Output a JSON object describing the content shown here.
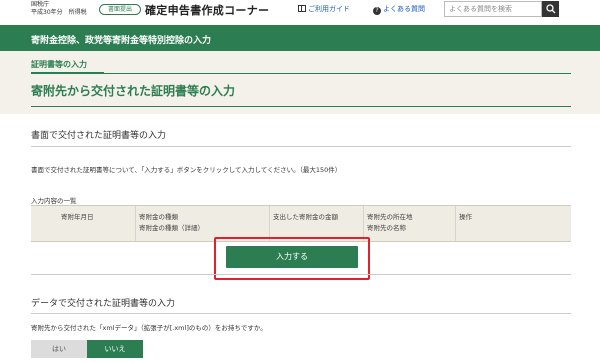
{
  "header": {
    "agency_line1": "国税庁",
    "agency_line2": "平成30年分　所得税",
    "badge": "書面提出",
    "app_title": "確定申告書作成コーナー",
    "guide_link": "ご利用ガイド",
    "faq_link": "よくある質問",
    "search_placeholder": "よくある質問を検索"
  },
  "band": {
    "title": "寄附金控除、政党等寄附金等特別控除の入力"
  },
  "section": {
    "step_label": "証明書等の入力",
    "page_title": "寄附先から交付された証明書等の入力"
  },
  "paper": {
    "heading": "書面で交付された証明書等の入力",
    "description": "書面で交付された証明書等について、「入力する」ボタンをクリックして入力してください。（最大150件）",
    "list_caption": "入力内容の一覧",
    "columns": [
      "寄附年月日",
      "寄附金の種類",
      "寄附金の種類（詳細）",
      "支出した寄附金の金額",
      "寄附先の所在地",
      "寄附先の名称",
      "操作"
    ],
    "input_button": "入力する"
  },
  "data": {
    "heading": "データで交付された証明書等の入力",
    "question": "寄附先から交付された「xmlデータ」（拡張子が[.xml]のもの）をお持ちですか。",
    "yes_label": "はい",
    "no_label": "いいえ",
    "selected": "いいえ"
  },
  "colors": {
    "brand_green": "#2c7d51",
    "highlight_red": "#e0232a",
    "link_blue": "#1a5bb3"
  },
  "icons": [
    "guide-book-icon",
    "question-circle-icon",
    "search-icon"
  ]
}
